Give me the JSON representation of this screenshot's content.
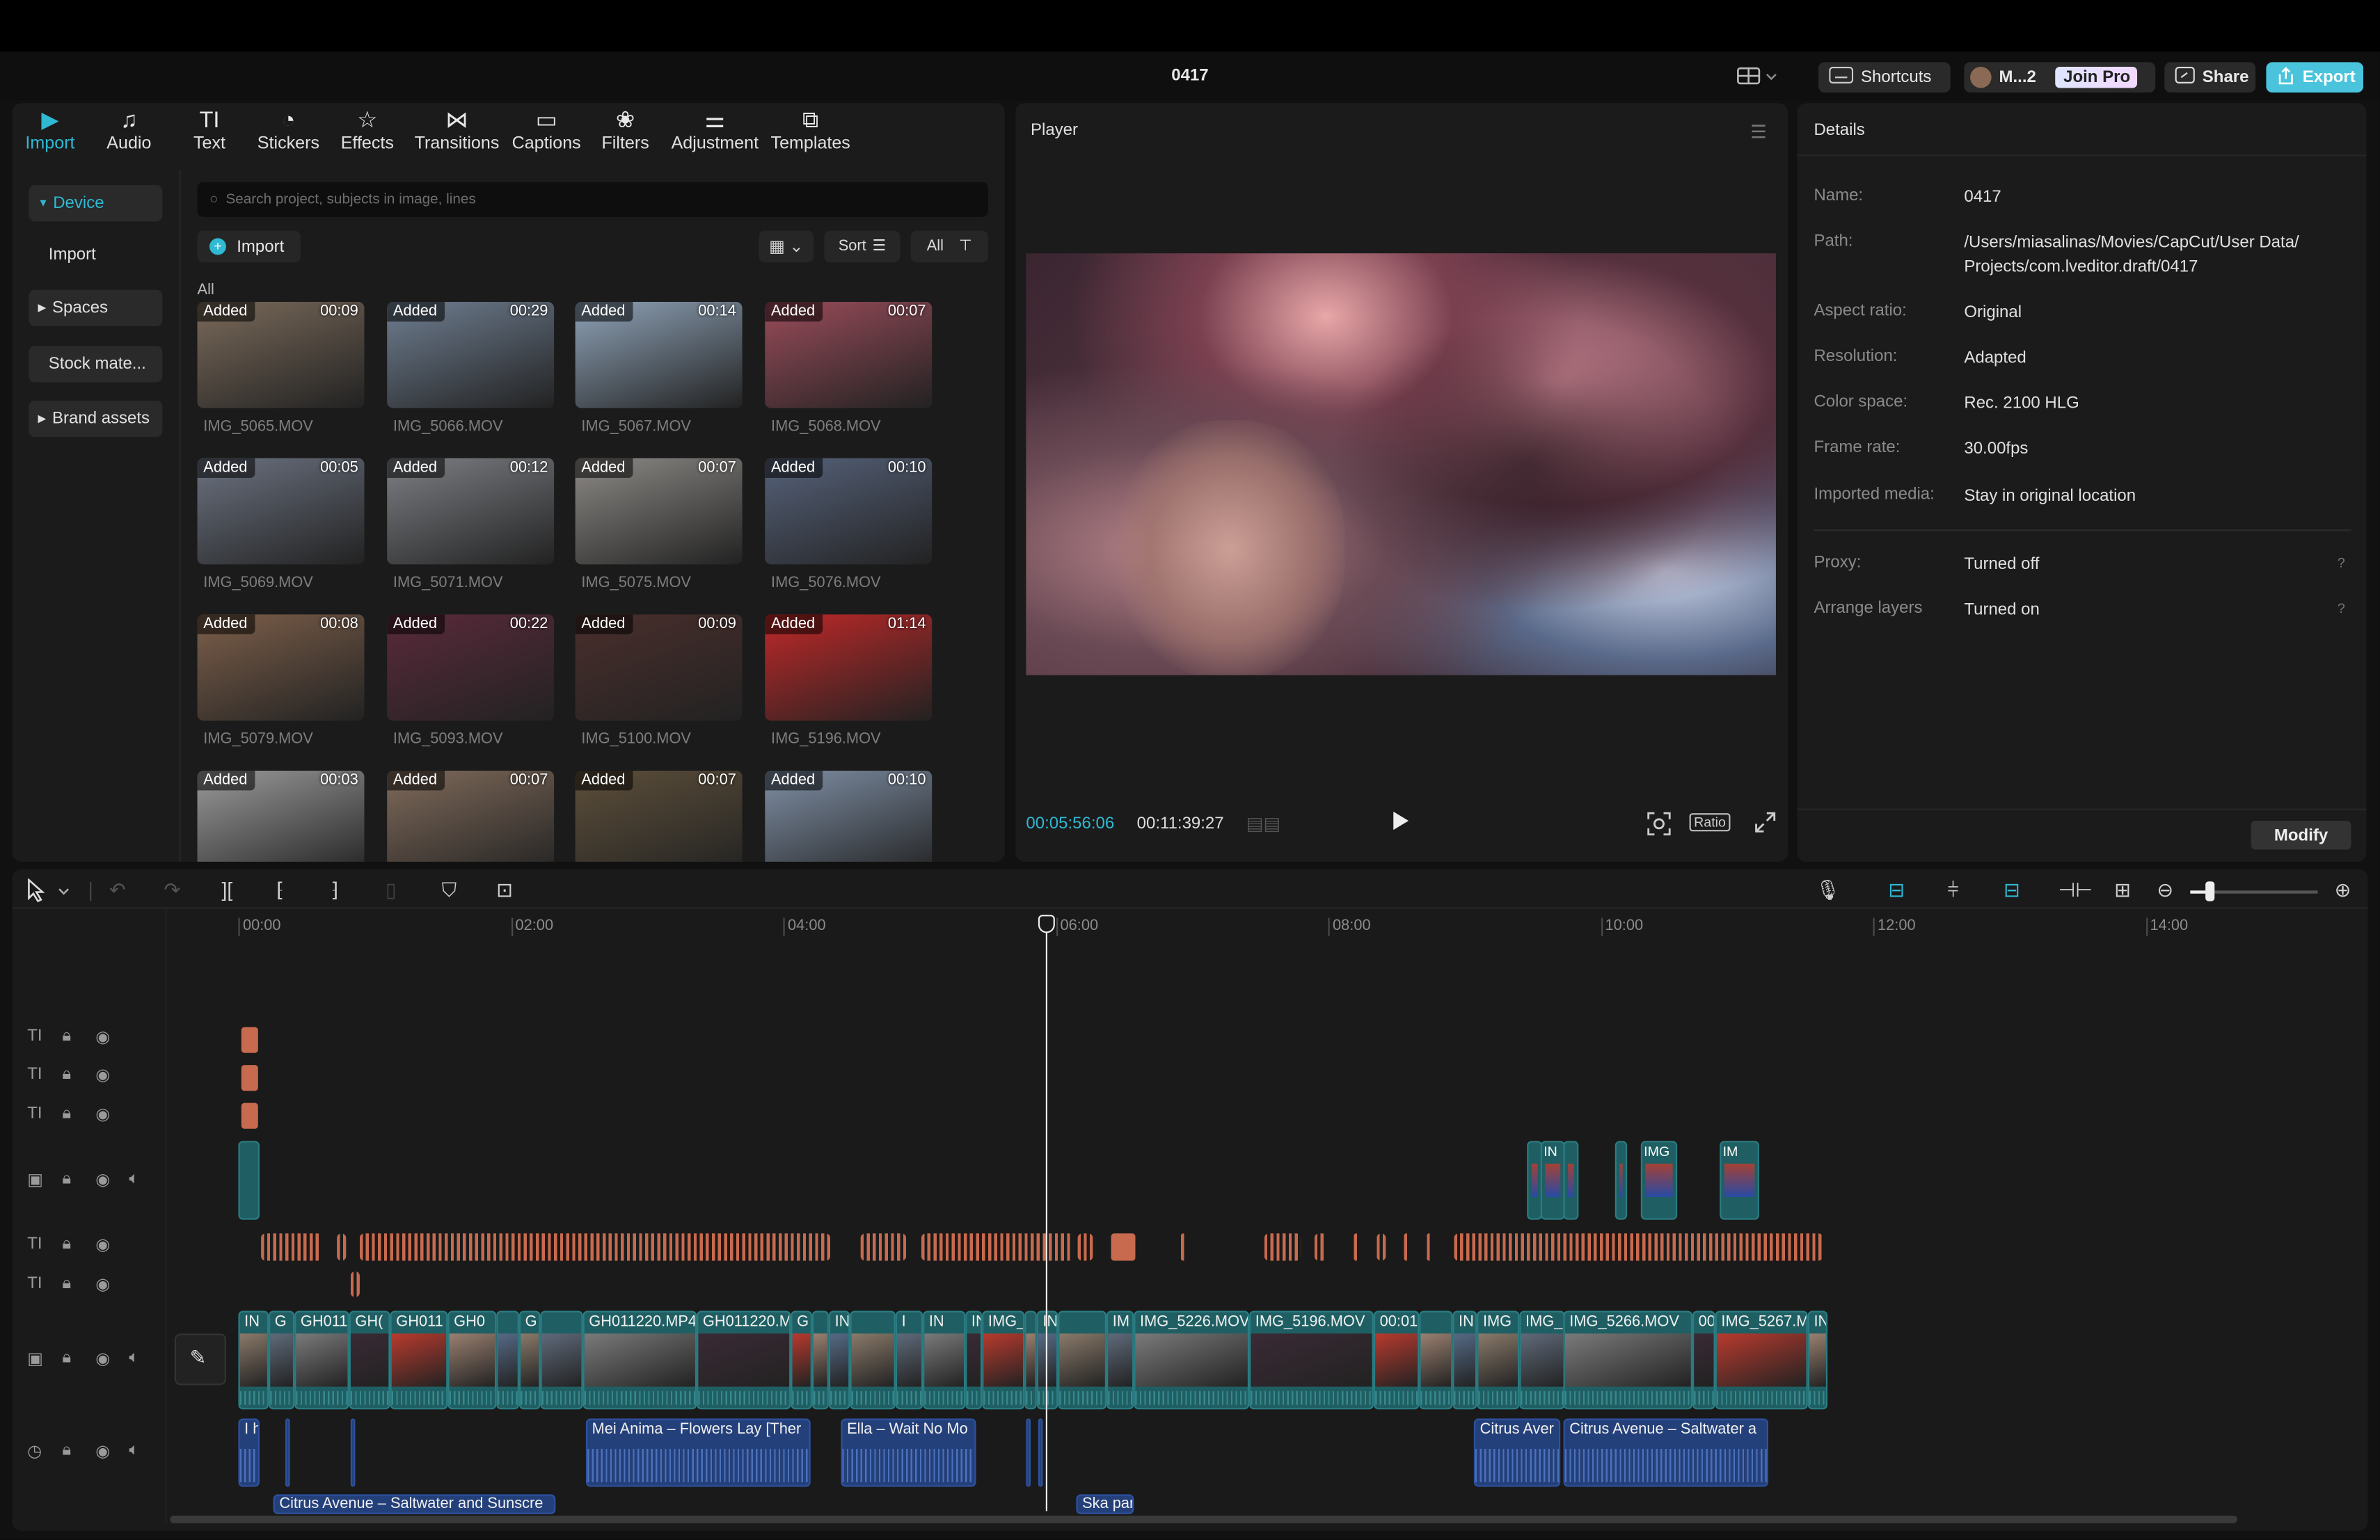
{
  "window": {
    "project_title": "0417"
  },
  "topbar": {
    "shortcuts": "Shortcuts",
    "account": "M...2",
    "join_pro": "Join Pro",
    "share": "Share",
    "export": "Export"
  },
  "media_tabs": [
    "Import",
    "Audio",
    "Text",
    "Stickers",
    "Effects",
    "Transitions",
    "Captions",
    "Filters",
    "Adjustment",
    "Templates"
  ],
  "sidebar": {
    "device": "Device",
    "import": "Import",
    "spaces": "Spaces",
    "stock": "Stock mate...",
    "brand": "Brand assets"
  },
  "media": {
    "search_placeholder": "Search project, subjects in image, lines",
    "import_button": "Import",
    "sort": "Sort",
    "all_filter": "All",
    "section_label": "All",
    "added_label": "Added",
    "items": [
      {
        "name": "IMG_5065.MOV",
        "dur": "00:09",
        "color": "#7a6a5a"
      },
      {
        "name": "IMG_5066.MOV",
        "dur": "00:29",
        "color": "#6f7e91"
      },
      {
        "name": "IMG_5067.MOV",
        "dur": "00:14",
        "color": "#8fa3b8"
      },
      {
        "name": "IMG_5068.MOV",
        "dur": "00:07",
        "color": "#9a4c5a"
      },
      {
        "name": "IMG_5069.MOV",
        "dur": "00:05",
        "color": "#6b7280"
      },
      {
        "name": "IMG_5071.MOV",
        "dur": "00:12",
        "color": "#7c7f84"
      },
      {
        "name": "IMG_5075.MOV",
        "dur": "00:07",
        "color": "#8d8a86"
      },
      {
        "name": "IMG_5076.MOV",
        "dur": "00:10",
        "color": "#56627a"
      },
      {
        "name": "IMG_5079.MOV",
        "dur": "00:08",
        "color": "#7d5f4a"
      },
      {
        "name": "IMG_5093.MOV",
        "dur": "00:22",
        "color": "#5a2a3a"
      },
      {
        "name": "IMG_5100.MOV",
        "dur": "00:09",
        "color": "#4a2f2c"
      },
      {
        "name": "IMG_5196.MOV",
        "dur": "01:14",
        "color": "#c02828"
      },
      {
        "name": "",
        "dur": "00:03",
        "color": "#9a9a9a"
      },
      {
        "name": "",
        "dur": "00:07",
        "color": "#7f6a5a"
      },
      {
        "name": "",
        "dur": "00:07",
        "color": "#5d4f3a"
      },
      {
        "name": "",
        "dur": "00:10",
        "color": "#7f8fa5"
      }
    ]
  },
  "player": {
    "title": "Player",
    "current_time": "00:05:56:06",
    "total_time": "00:11:39:27",
    "ratio": "Ratio"
  },
  "details": {
    "title": "Details",
    "rows": [
      {
        "key": "Name:",
        "value": "0417"
      },
      {
        "key": "Path:",
        "value": "/Users/miasalinas/Movies/CapCut/User Data/ Projects/com.lveditor.draft/0417"
      },
      {
        "key": "Aspect ratio:",
        "value": "Original"
      },
      {
        "key": "Resolution:",
        "value": "Adapted"
      },
      {
        "key": "Color space:",
        "value": "Rec. 2100 HLG"
      },
      {
        "key": "Frame rate:",
        "value": "30.00fps"
      },
      {
        "key": "Imported media:",
        "value": "Stay in original location"
      },
      {
        "key": "Proxy:",
        "value": "Turned off"
      },
      {
        "key": "Arrange layers",
        "value": "Turned on"
      }
    ],
    "modify": "Modify"
  },
  "timeline": {
    "ruler": [
      "00:00",
      "02:00",
      "04:00",
      "06:00",
      "08:00",
      "10:00",
      "12:00",
      "14:00"
    ],
    "main_clips": [
      {
        "label": "IN"
      },
      {
        "label": "G"
      },
      {
        "label": "GH011"
      },
      {
        "label": "GH("
      },
      {
        "label": "GH011"
      },
      {
        "label": "GH0"
      },
      {
        "label": "G"
      },
      {
        "label": "GH011220.MP4"
      },
      {
        "label": "GH011220.M"
      },
      {
        "label": "G"
      },
      {
        "label": "IN"
      },
      {
        "label": "I"
      },
      {
        "label": "IN"
      },
      {
        "label": "IN"
      },
      {
        "label": "IMG_"
      },
      {
        "label": "IN"
      },
      {
        "label": "IM"
      },
      {
        "label": "IMG_5226.MOV"
      },
      {
        "label": "IMG_5196.MOV"
      },
      {
        "label": "00:01"
      },
      {
        "label": "IN"
      },
      {
        "label": "IMG"
      },
      {
        "label": "IMG_"
      },
      {
        "label": "IMG_5266.MOV"
      },
      {
        "label": "00"
      },
      {
        "label": "IMG_5267.M"
      },
      {
        "label": "IN"
      }
    ],
    "overlay_clips": [
      {
        "label": "IN"
      },
      {
        "label": "IMG"
      },
      {
        "label": "IM"
      }
    ],
    "audio_clips": [
      {
        "label": "I h"
      },
      {
        "label": "Mei Anima – Flowers Lay [Ther"
      },
      {
        "label": "Ella – Wait No Mo"
      },
      {
        "label": "Citrus Aver"
      },
      {
        "label": "Citrus Avenue – Saltwater a"
      }
    ],
    "audio2_clips": [
      {
        "label": "Citrus Avenue – Saltwater and Sunscre"
      },
      {
        "label": "Ska par"
      }
    ]
  }
}
